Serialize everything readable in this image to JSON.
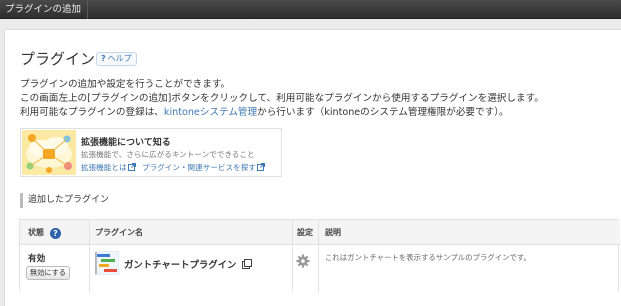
{
  "topbar": {
    "tab_label": "プラグインの追加"
  },
  "page": {
    "title": "プラグイン",
    "help_label": "ヘルプ",
    "desc_line1": "プラグインの追加や設定を行うことができます。",
    "desc_line2": "この画面左上の[プラグインの追加]ボタンをクリックして、利用可能なプラグインから使用するプラグインを選択します。",
    "desc_line3_prefix": "利用可能なプラグインの登録は、",
    "desc_line3_link": "kintoneシステム管理",
    "desc_line3_suffix": "から行います（kintoneのシステム管理権限が必要です）。"
  },
  "info_card": {
    "title": "拡張機能について知る",
    "subtitle": "拡張機能で、さらに広がるキントーンでできること",
    "link1": "拡張機能とは",
    "link2": "プラグイン・関連サービスを探す"
  },
  "section": {
    "title": "追加したプラグイン"
  },
  "table": {
    "headers": {
      "status": "状態",
      "name": "プラグイン名",
      "settings": "設定",
      "description": "説明"
    },
    "rows": [
      {
        "status": "有効",
        "disable_button": "無効にする",
        "name": "ガントチャートプラグイン",
        "description": "これはガントチャートを表示するサンプルのプラグインです。"
      }
    ]
  },
  "icons": {
    "help": "question-icon",
    "external": "external-link-icon",
    "settings": "gear-icon",
    "plugin": "gantt-chart-icon"
  },
  "colors": {
    "link": "#3c78b4",
    "topbar": "#383838",
    "help_badge": "#2d63a8"
  }
}
